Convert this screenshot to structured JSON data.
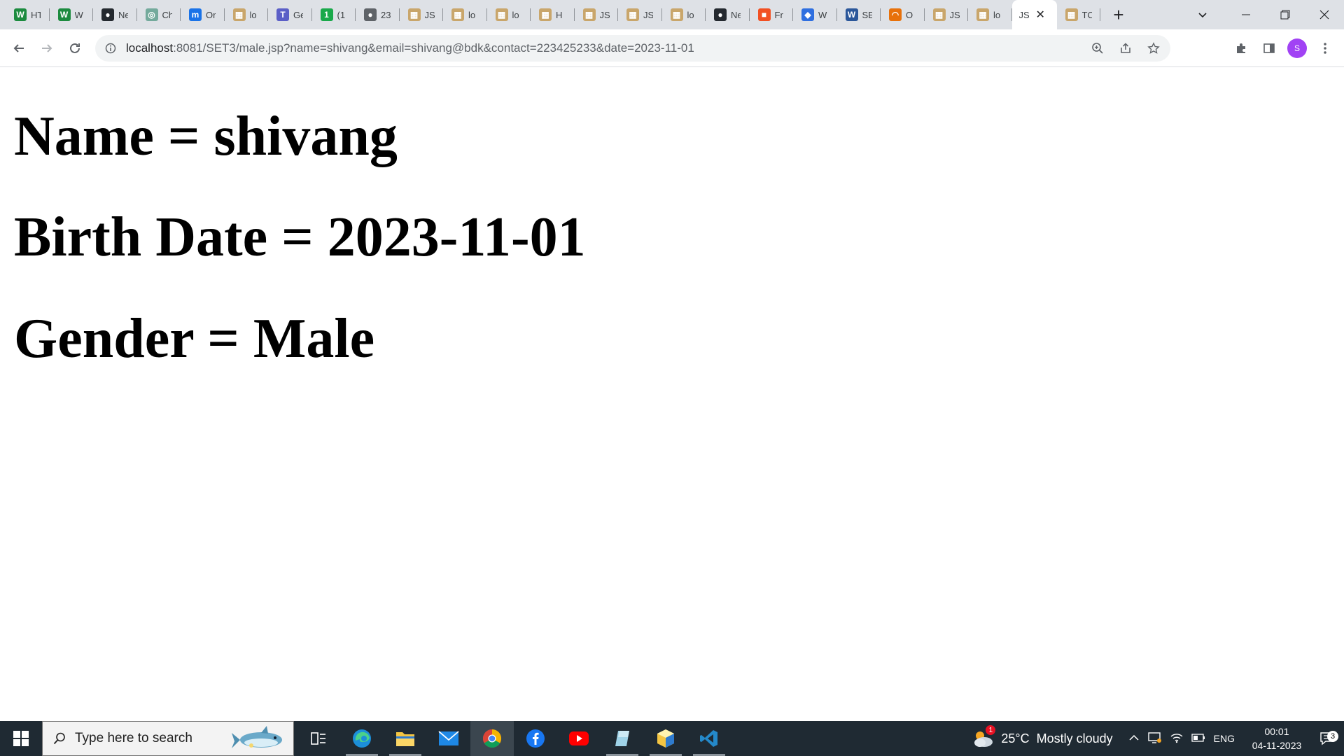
{
  "browser": {
    "tabs": [
      {
        "title": "HT",
        "icon": "w-icon",
        "color": "#1c8b3f",
        "glyph": "W"
      },
      {
        "title": "W",
        "icon": "w-icon",
        "color": "#1c8b3f",
        "glyph": "W"
      },
      {
        "title": "Ne",
        "icon": "github-icon",
        "color": "#24292f",
        "glyph": "●"
      },
      {
        "title": "Ch",
        "icon": "chatgpt-icon",
        "color": "#74aa9c",
        "glyph": "◎"
      },
      {
        "title": "Or",
        "icon": "m-icon",
        "color": "#1a73e8",
        "glyph": "m"
      },
      {
        "title": "lo",
        "icon": "broken-image-icon",
        "color": "#c9a66b",
        "glyph": "▦"
      },
      {
        "title": "Ge",
        "icon": "teams-icon",
        "color": "#5b5fc7",
        "glyph": "T"
      },
      {
        "title": "(1",
        "icon": "notification-icon",
        "color": "#19a94a",
        "glyph": "1"
      },
      {
        "title": "23",
        "icon": "globe-icon",
        "color": "#5f6368",
        "glyph": "●"
      },
      {
        "title": "JS",
        "icon": "broken-image-icon",
        "color": "#c9a66b",
        "glyph": "▦"
      },
      {
        "title": "lo",
        "icon": "broken-image-icon",
        "color": "#c9a66b",
        "glyph": "▦"
      },
      {
        "title": "lo",
        "icon": "broken-image-icon",
        "color": "#c9a66b",
        "glyph": "▦"
      },
      {
        "title": "H",
        "icon": "broken-image-icon",
        "color": "#c9a66b",
        "glyph": "▦"
      },
      {
        "title": "JS",
        "icon": "broken-image-icon",
        "color": "#c9a66b",
        "glyph": "▦"
      },
      {
        "title": "JS",
        "icon": "broken-image-icon",
        "color": "#c9a66b",
        "glyph": "▦"
      },
      {
        "title": "lo",
        "icon": "broken-image-icon",
        "color": "#c9a66b",
        "glyph": "▦"
      },
      {
        "title": "Ne",
        "icon": "github-icon",
        "color": "#24292f",
        "glyph": "●"
      },
      {
        "title": "Fr",
        "icon": "microsoft-icon",
        "color": "#f25022",
        "glyph": "■"
      },
      {
        "title": "W",
        "icon": "copilot-icon",
        "color": "#2f6fe0",
        "glyph": "◆"
      },
      {
        "title": "SE",
        "icon": "word-icon",
        "color": "#2b579a",
        "glyph": "W"
      },
      {
        "title": "O",
        "icon": "rainbow-icon",
        "color": "#e8710a",
        "glyph": "◠"
      },
      {
        "title": "JS",
        "icon": "broken-image-icon",
        "color": "#c9a66b",
        "glyph": "▦"
      },
      {
        "title": "lo",
        "icon": "broken-image-icon",
        "color": "#c9a66b",
        "glyph": "▦"
      },
      {
        "title": "JS",
        "icon": "none",
        "color": "#ffffff",
        "glyph": "",
        "active": true
      },
      {
        "title": "TC",
        "icon": "broken-image-icon",
        "color": "#c9a66b",
        "glyph": "▦"
      }
    ],
    "url_host": "localhost",
    "url_rest": ":8081/SET3/male.jsp?name=shivang&email=shivang@bdk&contact=223425233&date=2023-11-01",
    "profile_initial": "S"
  },
  "page": {
    "name_line": "Name = shivang",
    "birth_line": "Birth Date = 2023-11-01",
    "gender_line": "Gender = Male"
  },
  "taskbar": {
    "search_placeholder": "Type here to search",
    "weather_temp": "25°C",
    "weather_desc": "Mostly cloudy",
    "weather_badge": "1",
    "lang": "ENG",
    "time": "00:01",
    "date": "04-11-2023",
    "notification_count": "3"
  }
}
